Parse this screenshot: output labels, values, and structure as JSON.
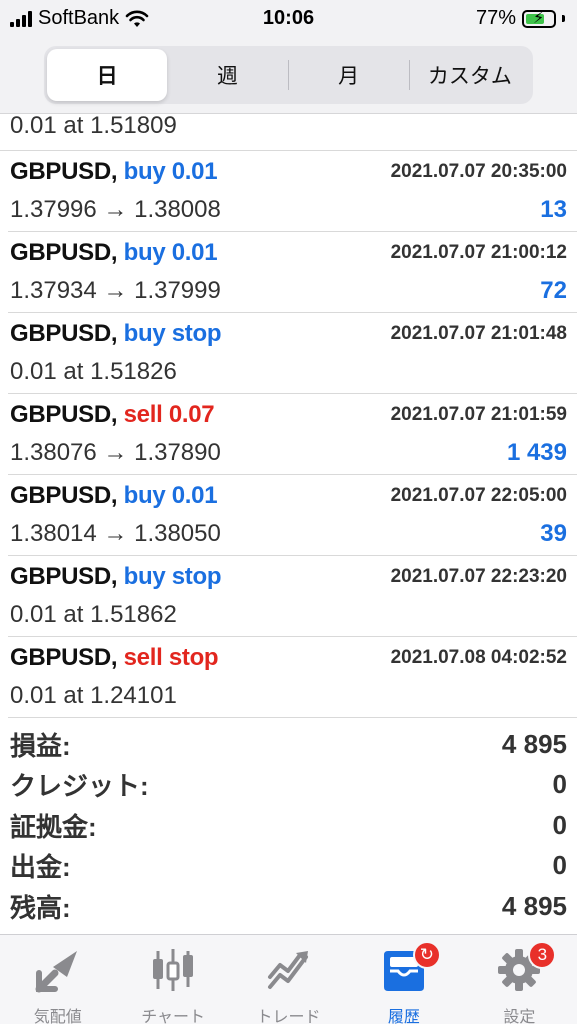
{
  "status_bar": {
    "carrier": "SoftBank",
    "time": "10:06",
    "battery": "77%"
  },
  "period_tabs": [
    {
      "label": "日",
      "active": true
    },
    {
      "label": "週",
      "active": false
    },
    {
      "label": "月",
      "active": false
    },
    {
      "label": "カスタム",
      "active": false
    }
  ],
  "partial_row": {
    "detail": "0.01 at 1.51809"
  },
  "orders": [
    {
      "symbol": "GBPUSD,",
      "action": "buy 0.01",
      "side": "buy",
      "time": "2021.07.07 20:35:00",
      "detail": "1.37996 → 1.38008",
      "profit": "13"
    },
    {
      "symbol": "GBPUSD,",
      "action": "buy 0.01",
      "side": "buy",
      "time": "2021.07.07 21:00:12",
      "detail": "1.37934 → 1.37999",
      "profit": "72"
    },
    {
      "symbol": "GBPUSD,",
      "action": "buy stop",
      "side": "buy",
      "time": "2021.07.07 21:01:48",
      "detail": "0.01 at 1.51826",
      "profit": ""
    },
    {
      "symbol": "GBPUSD,",
      "action": "sell 0.07",
      "side": "sell",
      "time": "2021.07.07 21:01:59",
      "detail": "1.38076 → 1.37890",
      "profit": "1 439"
    },
    {
      "symbol": "GBPUSD,",
      "action": "buy 0.01",
      "side": "buy",
      "time": "2021.07.07 22:05:00",
      "detail": "1.38014 → 1.38050",
      "profit": "39"
    },
    {
      "symbol": "GBPUSD,",
      "action": "buy stop",
      "side": "buy",
      "time": "2021.07.07 22:23:20",
      "detail": "0.01 at 1.51862",
      "profit": ""
    },
    {
      "symbol": "GBPUSD,",
      "action": "sell stop",
      "side": "sell",
      "time": "2021.07.08 04:02:52",
      "detail": "0.01 at 1.24101",
      "profit": ""
    }
  ],
  "summary": [
    {
      "label": "損益:",
      "value": "4 895"
    },
    {
      "label": "クレジット:",
      "value": "0"
    },
    {
      "label": "証拠金:",
      "value": "0"
    },
    {
      "label": "出金:",
      "value": "0"
    },
    {
      "label": "残高:",
      "value": "4 895"
    }
  ],
  "tabbar": [
    {
      "label": "気配値",
      "icon": "quotes-icon",
      "active": false,
      "badge": ""
    },
    {
      "label": "チャート",
      "icon": "chart-icon",
      "active": false,
      "badge": ""
    },
    {
      "label": "トレード",
      "icon": "trade-icon",
      "active": false,
      "badge": ""
    },
    {
      "label": "履歴",
      "icon": "history-icon",
      "active": true,
      "badge": "↻"
    },
    {
      "label": "設定",
      "icon": "settings-icon",
      "active": false,
      "badge": "3"
    }
  ],
  "colors": {
    "buy": "#1a6fe0",
    "sell": "#e2261e",
    "active_tab": "#1a6fe0",
    "inactive_icon": "#8a8a8e",
    "badge": "#e8302a"
  }
}
